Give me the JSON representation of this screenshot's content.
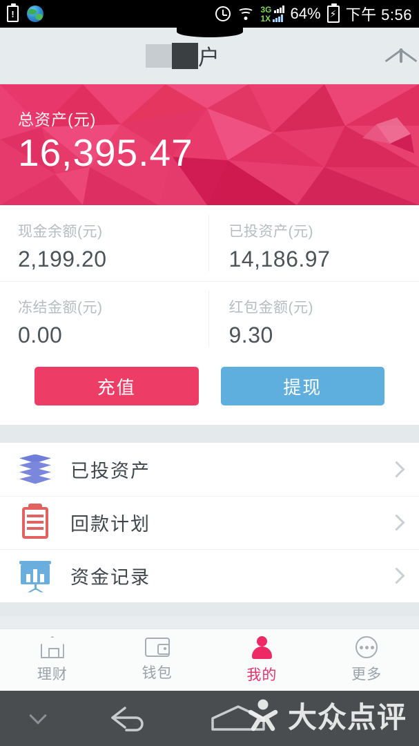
{
  "status_bar": {
    "icons_left": [
      "battery-warning-icon",
      "globe-icon"
    ],
    "icons_right": [
      "alarm-icon",
      "wifi-icon",
      "signal-3g-icon",
      "signal-1x-icon"
    ],
    "signal_3g_label": "3G",
    "signal_1x_label": "1X",
    "battery_percent": "64%",
    "time": "下午 5:56"
  },
  "header": {
    "title": "户",
    "title_redacted": true,
    "mail_icon": "envelope-icon"
  },
  "hero": {
    "label": "总资产(元)",
    "value": "16,395.47",
    "bg_color": "#e8386b"
  },
  "stats": [
    {
      "label": "现金余额(元)",
      "value": "2,199.20"
    },
    {
      "label": "已投资产(元)",
      "value": "14,186.97"
    },
    {
      "label": "冻结金额(元)",
      "value": "0.00"
    },
    {
      "label": "红包金额(元)",
      "value": "9.30"
    }
  ],
  "actions": {
    "recharge_label": "充值",
    "recharge_color": "#ed3d67",
    "withdraw_label": "提现",
    "withdraw_color": "#5eaede"
  },
  "menu": [
    {
      "label": "已投资产",
      "icon": "layers-icon",
      "chevron": "chevron-right-icon"
    },
    {
      "label": "回款计划",
      "icon": "clipboard-icon",
      "chevron": "chevron-right-icon"
    },
    {
      "label": "资金记录",
      "icon": "presentation-chart-icon",
      "chevron": "chevron-right-icon"
    }
  ],
  "tabs": [
    {
      "label": "理财",
      "icon": "home-icon",
      "active": false
    },
    {
      "label": "钱包",
      "icon": "wallet-icon",
      "active": false
    },
    {
      "label": "我的",
      "icon": "person-icon",
      "active": true
    },
    {
      "label": "更多",
      "icon": "more-ellipsis-icon",
      "active": false
    }
  ],
  "nav_bar": {
    "hide_icon": "chevron-down-icon",
    "back_icon": "back-arrow-icon",
    "home_icon": "home-pentagon-icon"
  },
  "watermark": {
    "text": "大众点评",
    "logo": "dianping-person-logo"
  },
  "accent_color": "#ed2e68"
}
